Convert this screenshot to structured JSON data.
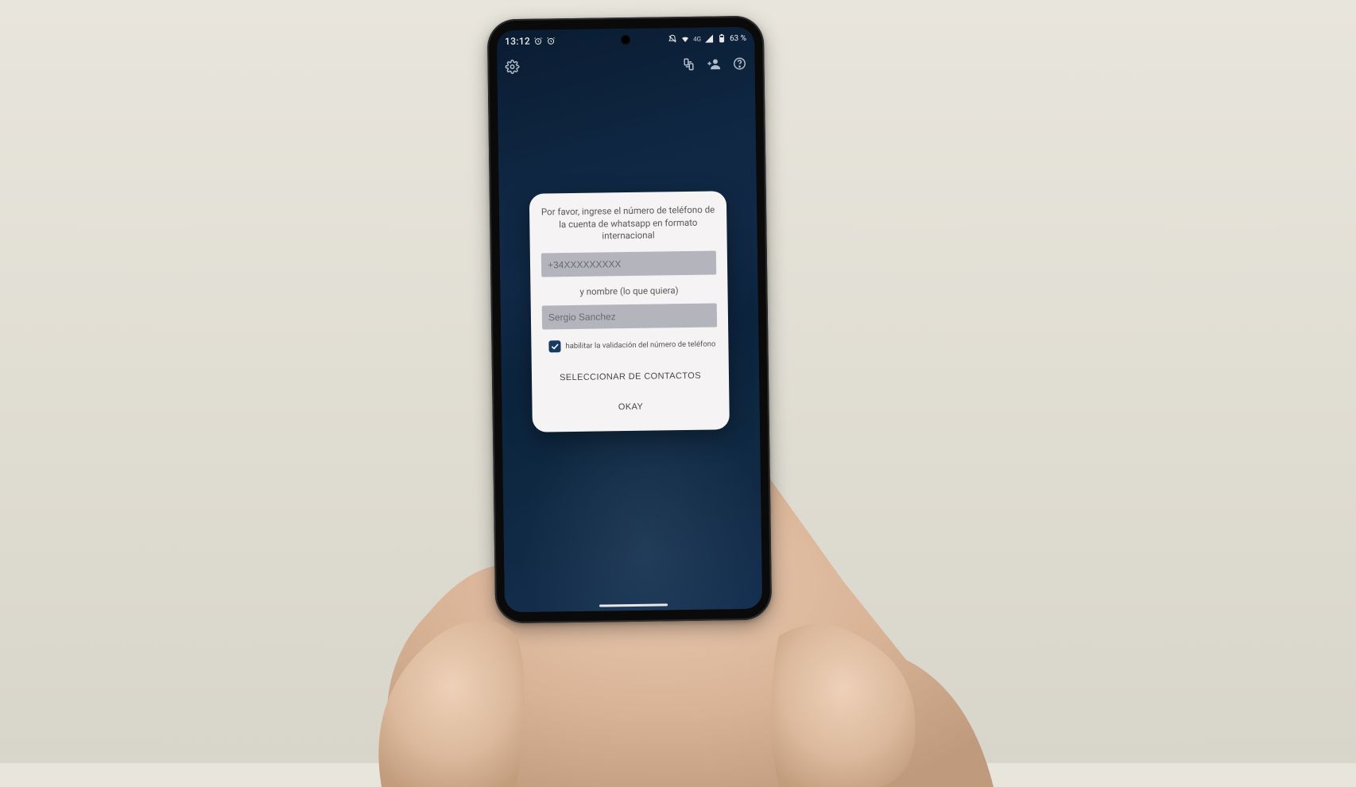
{
  "status": {
    "time": "13:12",
    "battery_text": "63 %",
    "wifi_label": "4G"
  },
  "dialog": {
    "title": "Por favor, ingrese el número de teléfono de la cuenta de whatsapp en formato internacional",
    "phone_placeholder": "+34XXXXXXXXX",
    "name_subtext": "y nombre (lo que quiera)",
    "name_placeholder": "Sergio Sanchez",
    "checkbox_label": "habilitar la validación del número de teléfono",
    "checkbox_checked": true,
    "select_contacts_label": "SELECCIONAR DE CONTACTOS",
    "okay_label": "OKAY"
  }
}
